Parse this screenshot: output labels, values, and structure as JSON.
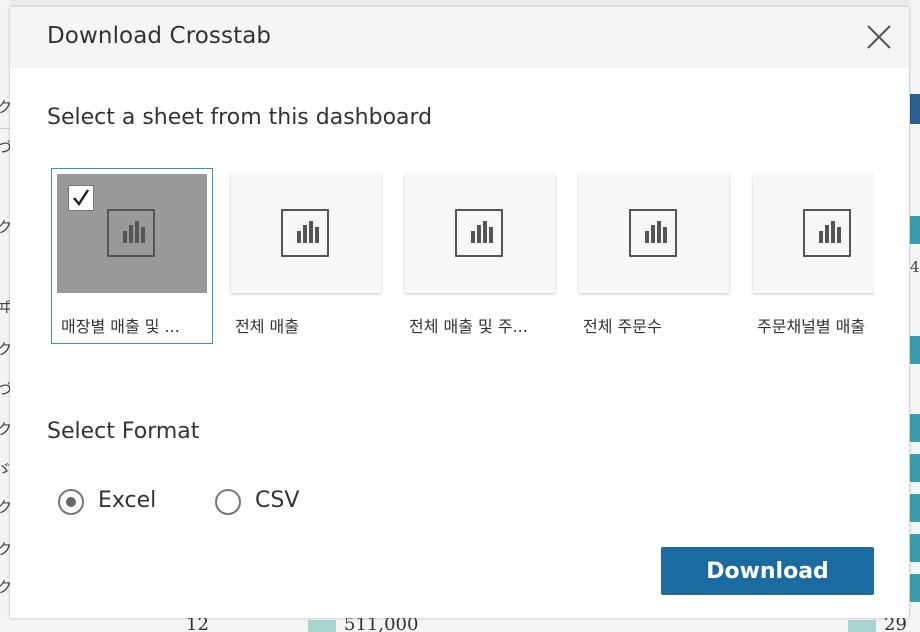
{
  "dialog": {
    "title": "Download Crosstab",
    "close_icon": "close-icon",
    "sheet_section_label": "Select a sheet from this dashboard",
    "format_section_label": "Select Format",
    "download_label": "Download"
  },
  "sheets": [
    {
      "label": "매장별 매출 및 ...",
      "selected": true,
      "icon": "bar-chart-icon"
    },
    {
      "label": "전체 매출",
      "selected": false,
      "icon": "bar-chart-icon"
    },
    {
      "label": "전체 매출 및 주...",
      "selected": false,
      "icon": "bar-chart-icon"
    },
    {
      "label": "전체 주문수",
      "selected": false,
      "icon": "bar-chart-icon"
    },
    {
      "label": "주문채널별 매출",
      "selected": false,
      "icon": "bar-chart-icon"
    }
  ],
  "formats": [
    {
      "label": "Excel",
      "checked": true
    },
    {
      "label": "CSV",
      "checked": false
    }
  ],
  "background": {
    "bottom_values": [
      "12",
      "511,000",
      "29"
    ],
    "right_edge_value": "4",
    "colors": {
      "accent_blue": "#1c6ba0",
      "selection_outline": "#3f90d9",
      "teal": "#3a9cb0",
      "light_teal": "#a8d5d0"
    }
  }
}
